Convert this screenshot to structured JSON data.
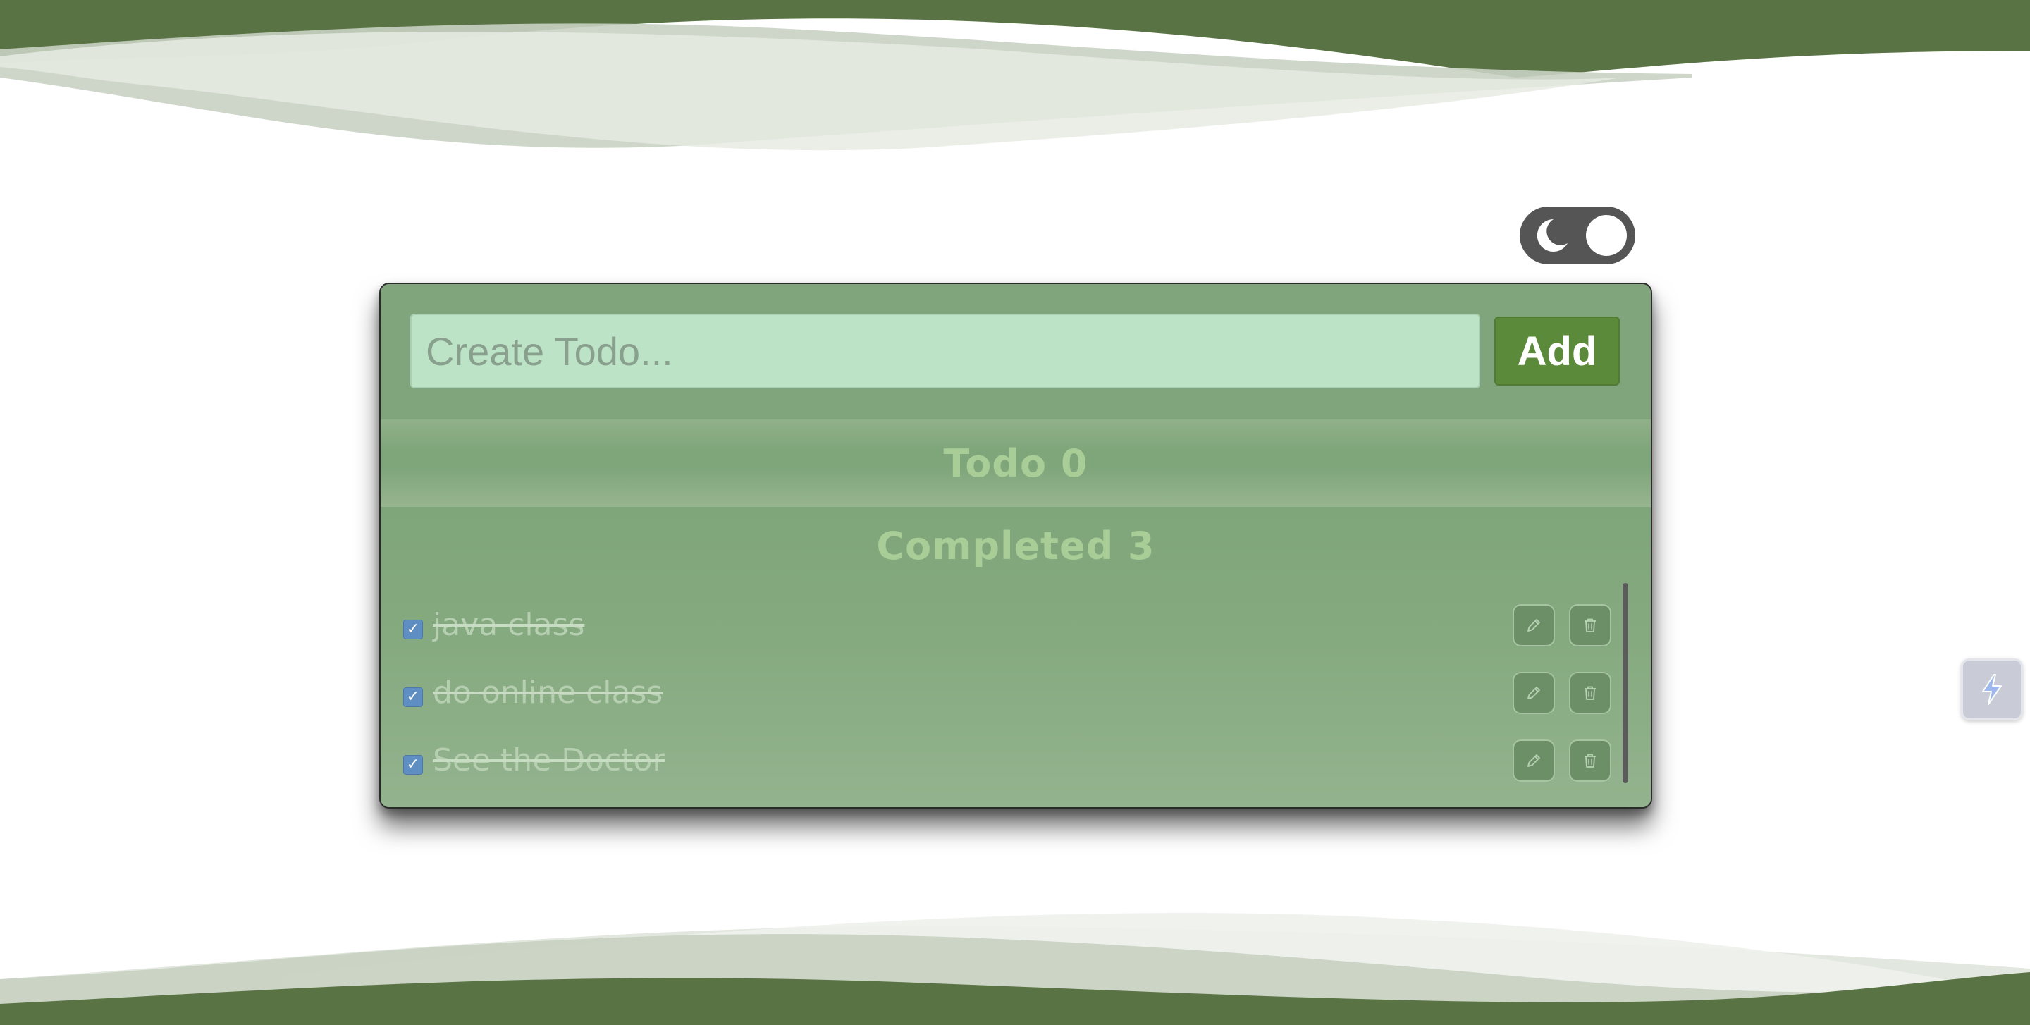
{
  "theme_toggle": {
    "icon": "moon-icon",
    "state": "light"
  },
  "create": {
    "placeholder": "Create Todo...",
    "value": "",
    "add_label": "Add"
  },
  "sections": {
    "todo": {
      "title": "Todo 0"
    },
    "completed": {
      "title": "Completed 3"
    }
  },
  "completed_items": [
    {
      "text": "java class",
      "checked": true
    },
    {
      "text": "do online class",
      "checked": true
    },
    {
      "text": "See the Doctor",
      "checked": true
    }
  ],
  "item_actions": {
    "edit_icon": "pencil-icon",
    "delete_icon": "trash-icon"
  },
  "side_widget": {
    "icon": "lightning-icon"
  },
  "colors": {
    "wave_dark": "#5a7344",
    "card_bg": "#7fa57b",
    "input_bg": "#bce3c5",
    "add_button": "#5c8a3b",
    "section_title": "#a9cd96",
    "checkbox": "#5f8fc2",
    "toggle_bg": "#555555"
  }
}
